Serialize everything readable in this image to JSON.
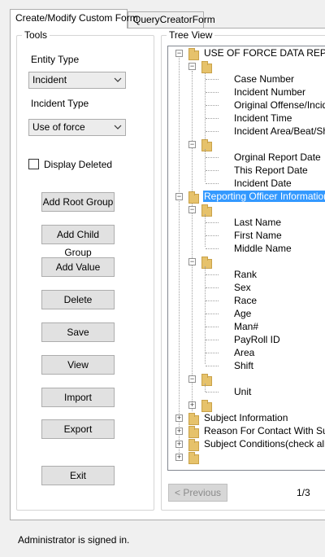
{
  "tabs": [
    {
      "label": "Create/Modify Custom Form",
      "active": true
    },
    {
      "label": "QueryCreatorForm",
      "active": false
    }
  ],
  "tools": {
    "title": "Tools",
    "entity_type_label": "Entity Type",
    "entity_type_value": "Incident",
    "incident_type_label": "Incident Type",
    "incident_type_value": "Use of force",
    "display_deleted_label": "Display Deleted",
    "display_deleted_checked": false,
    "buttons": {
      "add_root_group": "Add Root Group",
      "add_child_group": "Add Child Group",
      "add_value": "Add Value",
      "delete": "Delete",
      "save": "Save",
      "view": "View",
      "import": "Import",
      "export": "Export",
      "exit": "Exit"
    }
  },
  "tree": {
    "title": "Tree View",
    "root": "USE OF FORCE DATA REPOR",
    "group1_leaves": [
      "Case Number",
      "Incident Number",
      "Original Offense/Incider",
      "Incident Time",
      "Incident Area/Beat/Shif"
    ],
    "group2_leaves": [
      "Orginal Report Date",
      "This Report Date",
      "Incident Date"
    ],
    "selected": "Reporting Officer Information",
    "group3_leaves": [
      "Last Name",
      "First Name",
      "Middle Name"
    ],
    "group4_leaves": [
      "Rank",
      "Sex",
      "Race",
      "Age",
      "Man#",
      "PayRoll ID",
      "Area",
      "Shift"
    ],
    "group5_leaves": [
      "Unit"
    ],
    "collapsed": [
      "Subject Information",
      "Reason For Contact With Subje",
      "Subject Conditions(check all tha"
    ]
  },
  "pager": {
    "previous_label": "< Previous",
    "page_indicator": "1/3"
  },
  "status": {
    "text": "Administrator is signed in."
  }
}
